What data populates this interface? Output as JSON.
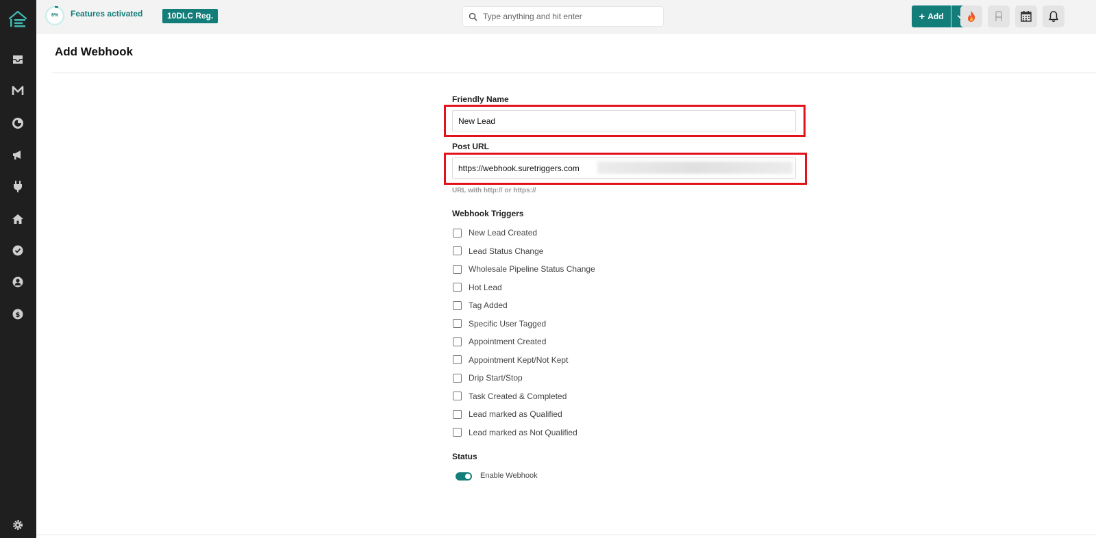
{
  "topbar": {
    "progress_pct": "6%",
    "progress_value": 0.06,
    "features_label": "Features activated",
    "badge": "10DLC Reg.",
    "search_placeholder": "Type anything and hit enter",
    "add_label": "Add"
  },
  "sidebar": {
    "icons": [
      "logo-icon",
      "inbox-icon",
      "gmail-icon",
      "chart-icon",
      "megaphone-icon",
      "plug-icon",
      "home-icon",
      "check-circle-icon",
      "user-icon",
      "dollar-icon",
      "gear-icon"
    ]
  },
  "page": {
    "title": "Add Webhook"
  },
  "form": {
    "friendly_name_label": "Friendly Name",
    "friendly_name_value": "New Lead",
    "post_url_label": "Post URL",
    "post_url_value": "https://webhook.suretriggers.com",
    "post_url_hint": "URL with http:// or https://",
    "triggers_label": "Webhook Triggers",
    "triggers": [
      "New Lead Created",
      "Lead Status Change",
      "Wholesale Pipeline Status Change",
      "Hot Lead",
      "Tag Added",
      "Specific User Tagged",
      "Appointment Created",
      "Appointment Kept/Not Kept",
      "Drip Start/Stop",
      "Task Created & Completed",
      "Lead marked as Qualified",
      "Lead marked as Not Qualified"
    ],
    "status_label": "Status",
    "enable_label": "Enable Webhook",
    "enabled": true
  },
  "colors": {
    "accent": "#137d7a",
    "highlight": "#e3111a",
    "sidebar": "#1f1f1f"
  }
}
